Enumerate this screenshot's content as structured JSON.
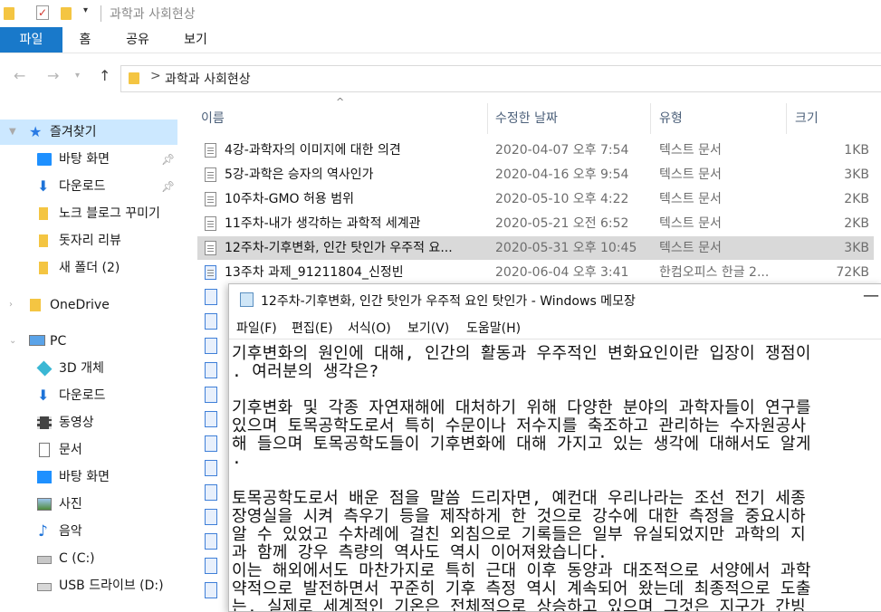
{
  "window_title": "과학과 사회현상",
  "ribbon_tabs": [
    "파일",
    "홈",
    "공유",
    "보기"
  ],
  "address": {
    "path": "과학과 사회현상",
    "separator": ">"
  },
  "nav": {
    "quick_access": "즐겨찾기",
    "items": [
      {
        "label": "바탕 화면",
        "icon": "desktop-icon",
        "pinned": true
      },
      {
        "label": "다운로드",
        "icon": "download-icon",
        "pinned": true
      },
      {
        "label": "노크 블로그 꾸미기",
        "icon": "folder-icon",
        "pinned": false
      },
      {
        "label": "돗자리 리뷰",
        "icon": "folder-icon",
        "pinned": false
      },
      {
        "label": "새 폴더 (2)",
        "icon": "folder-icon",
        "pinned": false
      }
    ],
    "onedrive": "OneDrive",
    "pc": "PC",
    "pc_items": [
      {
        "label": "3D 개체",
        "icon": "3d-objects-icon"
      },
      {
        "label": "다운로드",
        "icon": "download-icon"
      },
      {
        "label": "동영상",
        "icon": "video-icon"
      },
      {
        "label": "문서",
        "icon": "document-icon"
      },
      {
        "label": "바탕 화면",
        "icon": "desktop-icon"
      },
      {
        "label": "사진",
        "icon": "pictures-icon"
      },
      {
        "label": "음악",
        "icon": "music-icon"
      },
      {
        "label": "C (C:)",
        "icon": "drive-icon"
      },
      {
        "label": "USB 드라이브 (D:)",
        "icon": "usb-drive-icon"
      }
    ]
  },
  "columns": {
    "name": "이름",
    "modified": "수정한 날짜",
    "type": "유형",
    "size": "크기"
  },
  "files": [
    {
      "name": "4강-과학자의 이미지에 대한 의견",
      "date": "2020-04-07 오후 7:54",
      "type": "텍스트 문서",
      "size": "1KB"
    },
    {
      "name": "5강-과학은 승자의 역사인가",
      "date": "2020-04-16 오후 9:54",
      "type": "텍스트 문서",
      "size": "3KB"
    },
    {
      "name": "10주차-GMO 허용 범위",
      "date": "2020-05-10 오후 4:22",
      "type": "텍스트 문서",
      "size": "2KB"
    },
    {
      "name": "11주차-내가 생각하는 과학적 세계관",
      "date": "2020-05-21 오전 6:52",
      "type": "텍스트 문서",
      "size": "2KB"
    },
    {
      "name": "12주차-기후변화, 인간 탓인가 우주적 요...",
      "date": "2020-05-31 오후 10:45",
      "type": "텍스트 문서",
      "size": "3KB"
    },
    {
      "name": "13주차 과제_91211804_신정빈",
      "date": "2020-06-04 오후 3:41",
      "type": "한컴오피스 한글 2...",
      "size": "72KB"
    }
  ],
  "notepad": {
    "title": "12주차-기후변화, 인간 탓인가 우주적 요인 탓인가 - Windows 메모장",
    "menu": [
      "파일(F)",
      "편집(E)",
      "서식(O)",
      "보기(V)",
      "도움말(H)"
    ],
    "lines": [
      "기후변화의 원인에 대해, 인간의 활동과 우주적인 변화요인이란 입장이 쟁점이",
      ". 여러분의 생각은?",
      "",
      "기후변화 및 각종 자연재해에 대처하기 위해 다양한 분야의 과학자들이 연구를",
      "있으며 토목공학도로서 특히 수문이나 저수지를 축조하고 관리하는 수자원공사",
      "해 들으며 토목공학도들이 기후변화에 대해 가지고 있는 생각에 대해서도 알게",
      ".",
      "",
      "토목공학도로서 배운 점을 말씀 드리자면, 예컨대 우리나라는 조선 전기 세종",
      "장영실을 시켜 측우기 등을 제작하게 한 것으로 강수에 대한 측정을 중요시하",
      "알 수 있었고 수차례에 걸친 외침으로 기록들은 일부 유실되었지만 과학의 지",
      "과 함께 강우 측량의 역사도 역시 이어져왔습니다.",
      "이는 해외에서도 마찬가지로 특히 근대 이후 동양과 대조적으로 서양에서 과학",
      "약적으로 발전하면서 꾸준히 기후 측정 역시 계속되어 왔는데 최종적으로 도출",
      "는, 실제로 세계적인 기온은 전체적으로 상승하고 있으며 그것은 지구가 간빙"
    ]
  }
}
